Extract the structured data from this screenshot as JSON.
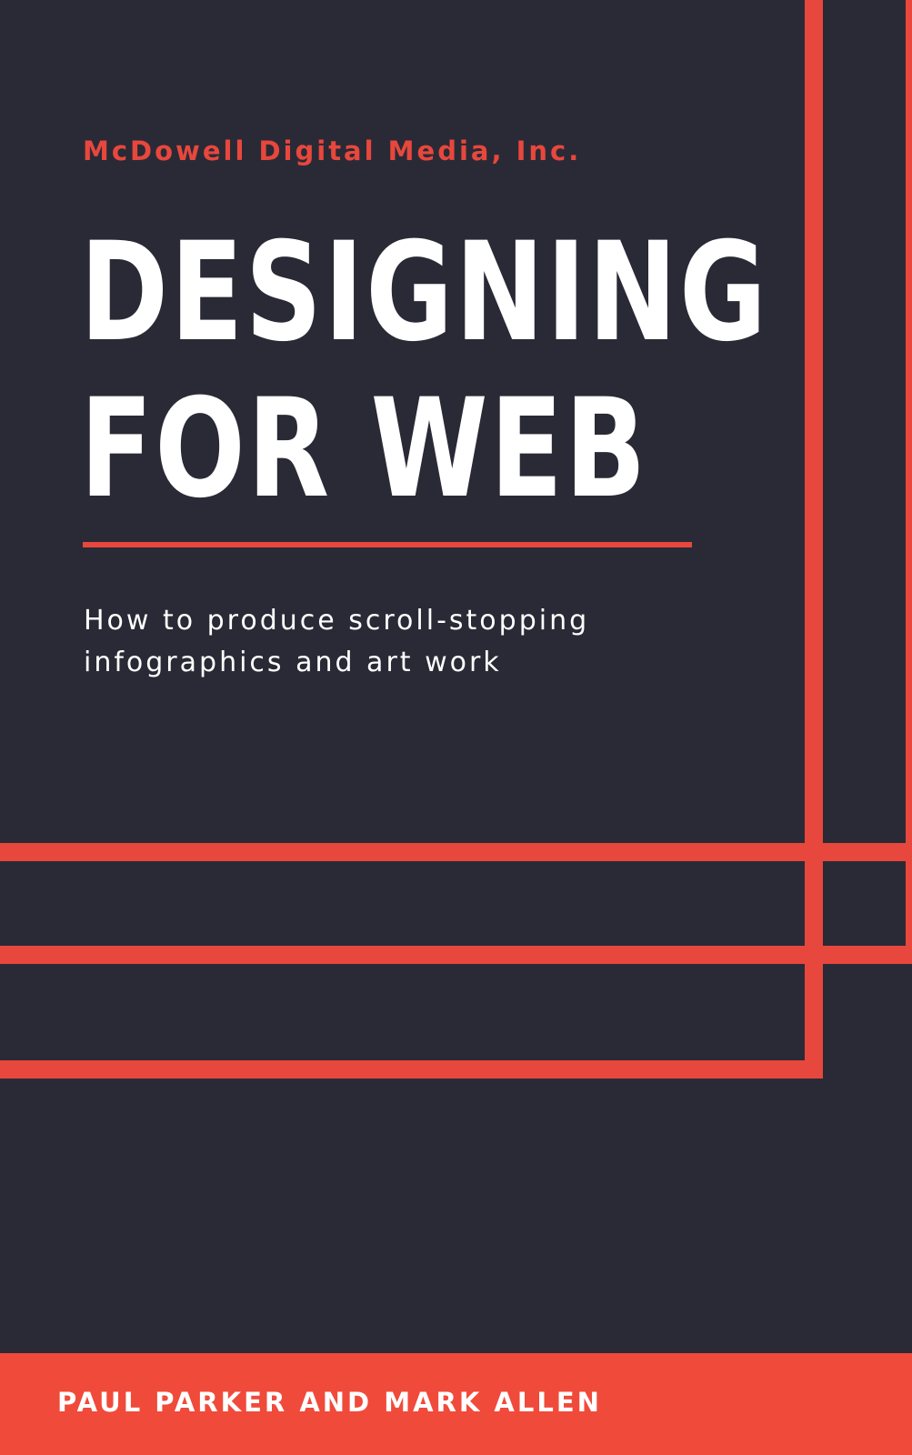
{
  "cover": {
    "publisher": "McDowell Digital Media, Inc.",
    "title_lines": [
      "DESIGNING",
      "FOR WEB"
    ],
    "subtitle_lines": [
      "How to produce scroll-stopping",
      "infographics and art work"
    ],
    "authors": "PAUL PARKER AND MARK ALLEN"
  },
  "colors": {
    "background": "#2a2a36",
    "accent": "#e8473d",
    "band": "#f04a3b",
    "text": "#ffffff"
  }
}
